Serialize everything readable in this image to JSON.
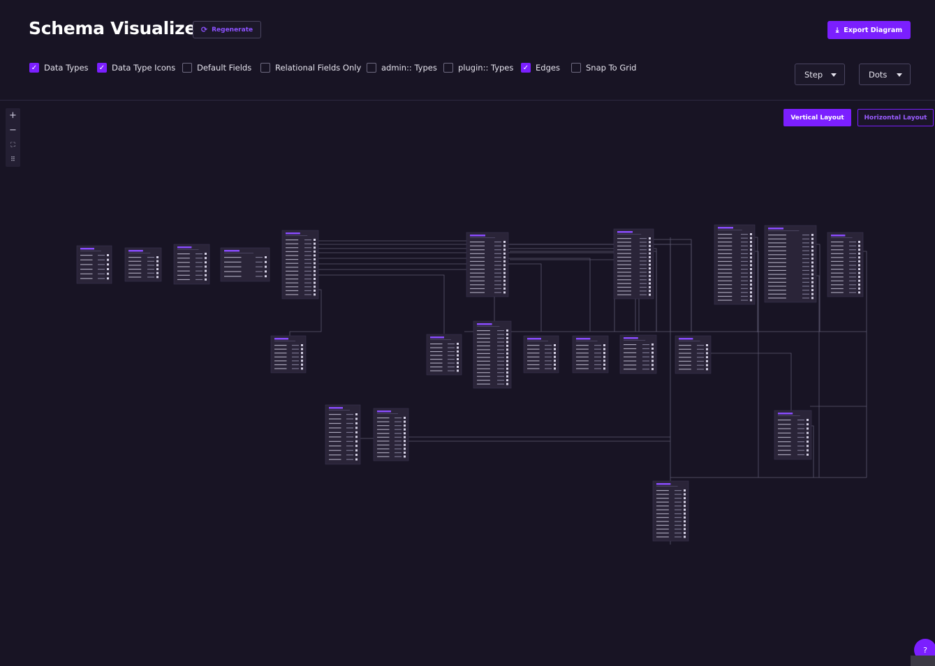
{
  "header": {
    "title": "Schema Visualizer",
    "regenerate_label": "Regenerate",
    "export_label": "Export Diagram",
    "icons": {
      "regenerate": "refresh-icon",
      "export": "download-icon"
    }
  },
  "filters": [
    {
      "label": "Data Types",
      "checked": true
    },
    {
      "label": "Data Type Icons",
      "checked": true
    },
    {
      "label": "Default Fields",
      "checked": false
    },
    {
      "label": "Relational Fields Only",
      "checked": false
    },
    {
      "label": "admin:: Types",
      "checked": false
    },
    {
      "label": "plugin:: Types",
      "checked": false
    },
    {
      "label": "Edges",
      "checked": true
    },
    {
      "label": "Snap To Grid",
      "checked": false
    }
  ],
  "selects": {
    "edge_type": "Step",
    "background": "Dots"
  },
  "layout_buttons": {
    "vertical": "Vertical Layout",
    "horizontal": "Horizontal Layout"
  },
  "zoom_controls": [
    "zoom-in-icon",
    "zoom-out-icon",
    "fit-view-icon",
    "interactive-lock-icon"
  ],
  "theme": {
    "accent": "#7b1fff",
    "background": "#181424",
    "node_bg": "#2a2438"
  },
  "help_icon": "help-icon"
}
